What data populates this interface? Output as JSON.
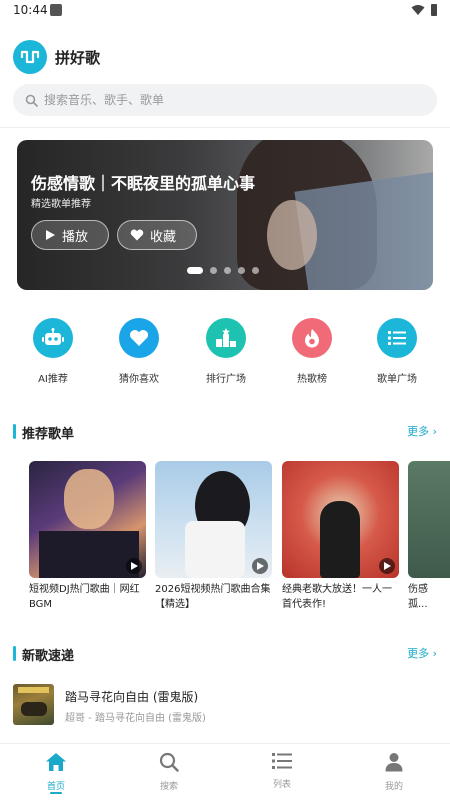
{
  "status_bar": {
    "time": "10:44"
  },
  "app": {
    "title": "拼好歌",
    "accent": "#1bb6d8"
  },
  "search": {
    "placeholder": "搜索音乐、歌手、歌单"
  },
  "banner": {
    "title": "伤感情歌｜不眠夜里的孤单心事",
    "subtitle": "精选歌单推荐",
    "play_label": "播放",
    "favorite_label": "收藏",
    "page_count": 5,
    "active_page": 1
  },
  "quick_entries": [
    {
      "label": "AI推荐",
      "icon": "robot-icon",
      "color": "#1bb6d8"
    },
    {
      "label": "猜你喜欢",
      "icon": "heart-icon",
      "color": "#1aa5e8"
    },
    {
      "label": "排行广场",
      "icon": "ranking-icon",
      "color": "#1dc3b0"
    },
    {
      "label": "热歌榜",
      "icon": "flame-icon",
      "color": "#f06a78"
    },
    {
      "label": "歌单广场",
      "icon": "list-icon",
      "color": "#1bb6d8"
    }
  ],
  "recommended": {
    "title": "推荐歌单",
    "more": "更多",
    "cards": [
      {
        "caption": "短视频DJ热门歌曲｜网红BGM"
      },
      {
        "caption": "2026短视频热门歌曲合集【精选】"
      },
      {
        "caption": "经典老歌大放送！一人一首代表作!"
      },
      {
        "caption": "伤感孤..."
      }
    ]
  },
  "new_songs": {
    "title": "新歌速递",
    "more": "更多",
    "items": [
      {
        "title": "踏马寻花向自由 (雷鬼版)",
        "subtitle": "超哥 - 踏马寻花向自由 (雷鬼版)"
      }
    ]
  },
  "tabs": [
    {
      "label": "首页",
      "icon": "home-icon",
      "active": true
    },
    {
      "label": "搜索",
      "icon": "search-icon",
      "active": false
    },
    {
      "label": "列表",
      "icon": "list-icon",
      "active": false
    },
    {
      "label": "我的",
      "icon": "user-icon",
      "active": false
    }
  ]
}
